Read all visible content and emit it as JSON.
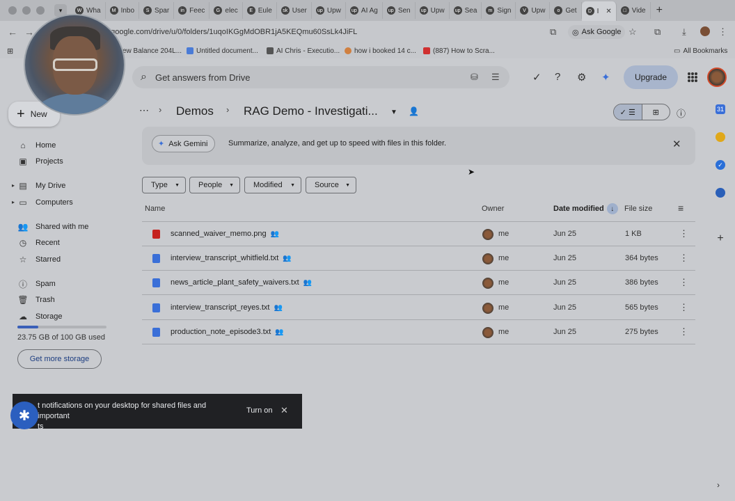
{
  "browser": {
    "tabs": [
      {
        "label": "Wha",
        "fav": "W"
      },
      {
        "label": "Inbo",
        "fav": "M"
      },
      {
        "label": "Spar",
        "fav": "S"
      },
      {
        "label": "Feec",
        "fav": "in"
      },
      {
        "label": "elec",
        "fav": "G"
      },
      {
        "label": "Eule",
        "fav": "E"
      },
      {
        "label": "User",
        "fav": "sk"
      },
      {
        "label": "Upw",
        "fav": "up"
      },
      {
        "label": "AI Ag",
        "fav": "up"
      },
      {
        "label": "Sen",
        "fav": "up"
      },
      {
        "label": "Upw",
        "fav": "up"
      },
      {
        "label": "Sea",
        "fav": "up"
      },
      {
        "label": "Sign",
        "fav": "m"
      },
      {
        "label": "Upw",
        "fav": "V"
      },
      {
        "label": "Get",
        "fav": "o"
      },
      {
        "label": "I",
        "fav": "D"
      },
      {
        "label": "Vide",
        "fav": "□"
      }
    ],
    "url": "e.google.com/drive/u/0/folders/1uqoIKGgMdOBR1jA5KEQmu60SsLk4JiFL",
    "ask_google": "Ask Google",
    "bookmarks": [
      "ew Balance 204L...",
      "Untitled document...",
      "AI Chris - Executio...",
      "how i booked 14 c...",
      "(887) How to Scra..."
    ],
    "all_bookmarks": "All Bookmarks"
  },
  "drive": {
    "search_placeholder": "Get answers from Drive",
    "upgrade_label": "Upgrade",
    "new_label": "New",
    "nav": [
      {
        "label": "Home",
        "icon": "home-icon",
        "glyph": "⌂"
      },
      {
        "label": "Projects",
        "icon": "projects-icon",
        "glyph": "▣"
      },
      {
        "label": "My Drive",
        "icon": "my-drive-icon",
        "glyph": "▤"
      },
      {
        "label": "Computers",
        "icon": "computers-icon",
        "glyph": "▭"
      },
      {
        "label": "Shared with me",
        "icon": "shared-icon",
        "glyph": "👥"
      },
      {
        "label": "Recent",
        "icon": "clock-icon",
        "glyph": "◷"
      },
      {
        "label": "Starred",
        "icon": "star-icon",
        "glyph": "☆"
      },
      {
        "label": "Spam",
        "icon": "spam-icon",
        "glyph": "ⓘ"
      },
      {
        "label": "Trash",
        "icon": "trash-icon",
        "glyph": "🗑"
      },
      {
        "label": "Storage",
        "icon": "cloud-icon",
        "glyph": "☁"
      }
    ],
    "storage": {
      "text": "23.75 GB of 100 GB used",
      "fraction": 0.2375
    },
    "get_storage_label": "Get more storage",
    "breadcrumb": {
      "parent": "Demos",
      "current": "RAG Demo - Investigati..."
    },
    "gemini": {
      "ask_label": "Ask Gemini",
      "message": "Summarize, analyze, and get up to speed with files in this folder."
    },
    "filters": [
      "Type",
      "People",
      "Modified",
      "Source"
    ],
    "columns": {
      "name": "Name",
      "owner": "Owner",
      "date": "Date modified",
      "size": "File size"
    },
    "files": [
      {
        "name": "scanned_waiver_memo.png",
        "type": "image",
        "color": "#c5221f",
        "owner": "me",
        "date": "Jun 25",
        "size": "1 KB"
      },
      {
        "name": "interview_transcript_whitfield.txt",
        "type": "doc",
        "color": "#3a6fd8",
        "owner": "me",
        "date": "Jun 25",
        "size": "364 bytes"
      },
      {
        "name": "news_article_plant_safety_waivers.txt",
        "type": "doc",
        "color": "#3a6fd8",
        "owner": "me",
        "date": "Jun 25",
        "size": "386 bytes"
      },
      {
        "name": "interview_transcript_reyes.txt",
        "type": "doc",
        "color": "#3a6fd8",
        "owner": "me",
        "date": "Jun 25",
        "size": "565 bytes"
      },
      {
        "name": "production_note_episode3.txt",
        "type": "doc",
        "color": "#3a6fd8",
        "owner": "me",
        "date": "Jun 25",
        "size": "275 bytes"
      }
    ],
    "snackbar": {
      "text": "t notifications on your desktop for shared files and important\nts",
      "action": "Turn on"
    }
  },
  "colors": {
    "accent": "#3a5fb8",
    "upgrade_bg": "#a8b5cc",
    "snackbar_bg": "#202124"
  }
}
